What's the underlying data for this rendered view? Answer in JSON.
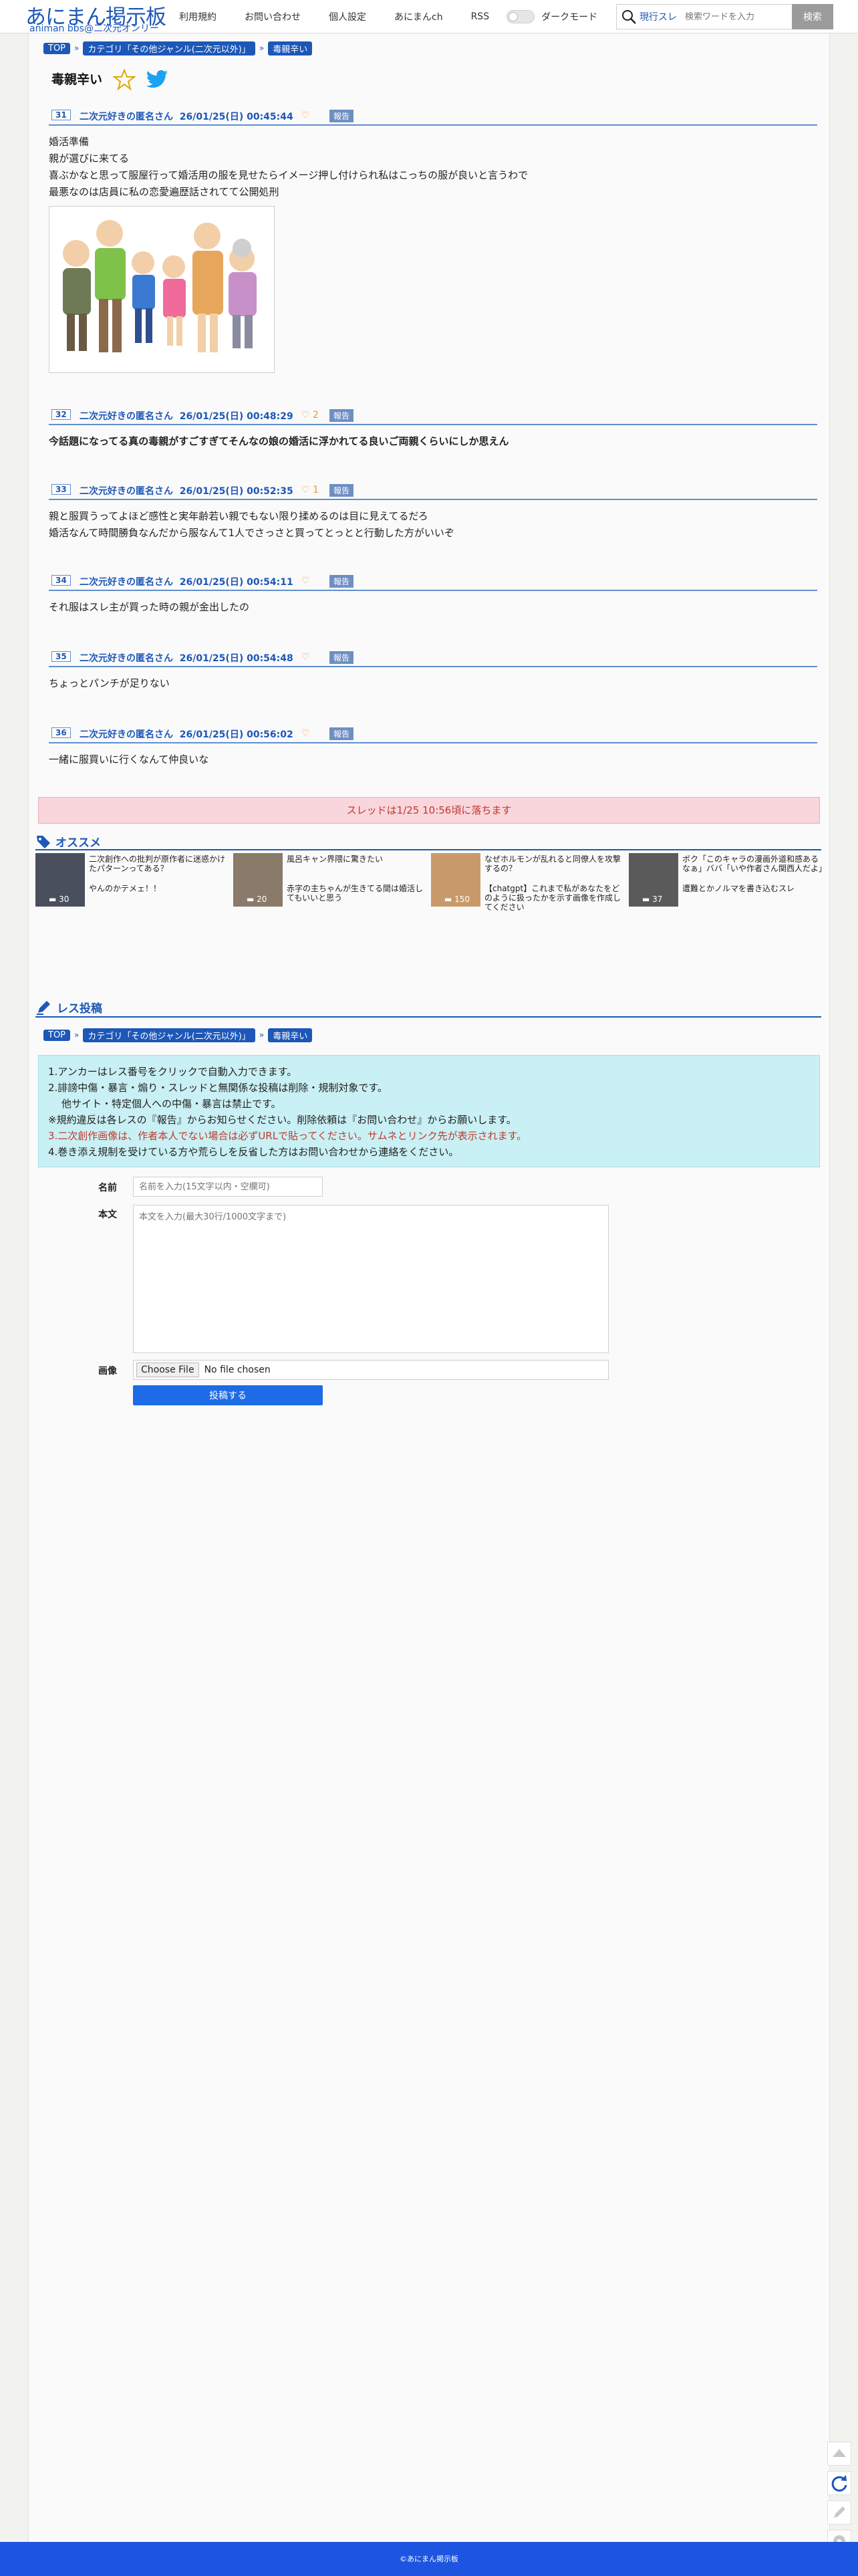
{
  "header": {
    "logo_main": "あにまん掲示板",
    "logo_sub": "animan bbs@二次元オンリー",
    "nav": [
      "利用規約",
      "お問い合わせ",
      "個人設定",
      "あにまんch",
      "RSS"
    ],
    "dark_mode_label": "ダークモード",
    "search_scope": "現行スレ",
    "search_placeholder": "検索ワードを入力",
    "search_button": "検索"
  },
  "breadcrumb": [
    "TOP",
    "カテゴリ「その他ジャンル(二次元以外)」",
    "毒親辛い"
  ],
  "thread_title": "毒親辛い",
  "posts": [
    {
      "no": "31",
      "name": "二次元好きの匿名さん",
      "date": "26/01/25(日) 00:45:44",
      "likes": "",
      "report": "報告",
      "lines": [
        "婚活準備",
        "親が選びに来てる",
        "喜ぶかなと思って服屋行って婚活用の服を見せたらイメージ押し付けられ私はこっちの服が良いと言うわで",
        "最悪なのは店員に私の恋愛遍歴話されてて公開処刑"
      ]
    },
    {
      "no": "32",
      "name": "二次元好きの匿名さん",
      "date": "26/01/25(日) 00:48:29",
      "likes": "2",
      "report": "報告",
      "lines": [
        "今話題になってる真の毒親がすごすぎてそんなの娘の婚活に浮かれてる良いご両親くらいにしか思えん"
      ]
    },
    {
      "no": "33",
      "name": "二次元好きの匿名さん",
      "date": "26/01/25(日) 00:52:35",
      "likes": "1",
      "report": "報告",
      "lines": [
        "親と服買うってよほど感性と実年齢若い親でもない限り揉めるのは目に見えてるだろ",
        "婚活なんて時間勝負なんだから服なんて1人でさっさと買ってとっとと行動した方がいいぞ"
      ]
    },
    {
      "no": "34",
      "name": "二次元好きの匿名さん",
      "date": "26/01/25(日) 00:54:11",
      "likes": "",
      "report": "報告",
      "lines": [
        "それ服はスレ主が買った時の親が金出したの"
      ]
    },
    {
      "no": "35",
      "name": "二次元好きの匿名さん",
      "date": "26/01/25(日) 00:54:48",
      "likes": "",
      "report": "報告",
      "lines": [
        "ちょっとパンチが足りない"
      ]
    },
    {
      "no": "36",
      "name": "二次元好きの匿名さん",
      "date": "26/01/25(日) 00:56:02",
      "likes": "",
      "report": "報告",
      "lines": [
        "一緒に服買いに行くなんて仲良いな"
      ]
    }
  ],
  "expiry_notice": "スレッドは1/25 10:56頃に落ちます",
  "recommend": {
    "title": "オススメ",
    "items": [
      {
        "text": "二次創作への批判が原作者に迷惑かけたパターンってある？",
        "sub": "やんのかテメェ！！",
        "count": "30"
      },
      {
        "text": "風呂キャン界隈に驚きたい",
        "sub": "赤字の主ちゃんが生きてる間は婚活してもいいと思う",
        "count": "20"
      },
      {
        "text": "なぜホルモンが乱れると同僚人を攻撃するの？",
        "sub": "【chatgpt】これまで私があなたをどのように扱ったかを示す画像を作成してください",
        "count": "150"
      },
      {
        "text": "ボク「このキャラの漫画外道和感あるなぁ」ババ「いや作者さん関西人だよ」",
        "sub": "遭難とかノルマを書き込むスレ",
        "count": "37"
      }
    ]
  },
  "reply": {
    "title": "レス投稿",
    "help": [
      "1.アンカーはレス番号をクリックで自動入力できます。",
      "2.誹謗中傷・暴言・煽り・スレッドと無関係な投稿は削除・規制対象です。",
      "他サイト・特定個人への中傷・暴言は禁止です。",
      "※規約違反は各レスの『報告』からお知らせください。削除依頼は『お問い合わせ』からお願いします。",
      "3.二次創作画像は、作者本人でない場合は必ずURLで貼ってください。サムネとリンク先が表示されます。",
      "4.巻き添え規制を受けている方や荒らしを反省した方はお問い合わせから連絡をください。"
    ],
    "name_label": "名前",
    "name_placeholder": "名前を入力(15文字以内・空欄可)",
    "body_label": "本文",
    "body_placeholder": "本文を入力(最大30行/1000文字まで)",
    "image_label": "画像",
    "file_button": "Choose File",
    "file_none": "No file chosen",
    "submit": "投稿する"
  },
  "footer": "©あにまん掲示板",
  "colors": {
    "brand": "#1d57b8",
    "notice_bg": "#f9d6dc",
    "help_bg": "#c9f0f4",
    "submit": "#1d6be6",
    "footer": "#1d55e0"
  },
  "icons": [
    "search-icon",
    "star-icon",
    "twitter-icon",
    "heart-icon",
    "tag-icon",
    "pencil-icon",
    "arrow-up-icon",
    "refresh-icon",
    "edit-icon",
    "gear-icon"
  ]
}
